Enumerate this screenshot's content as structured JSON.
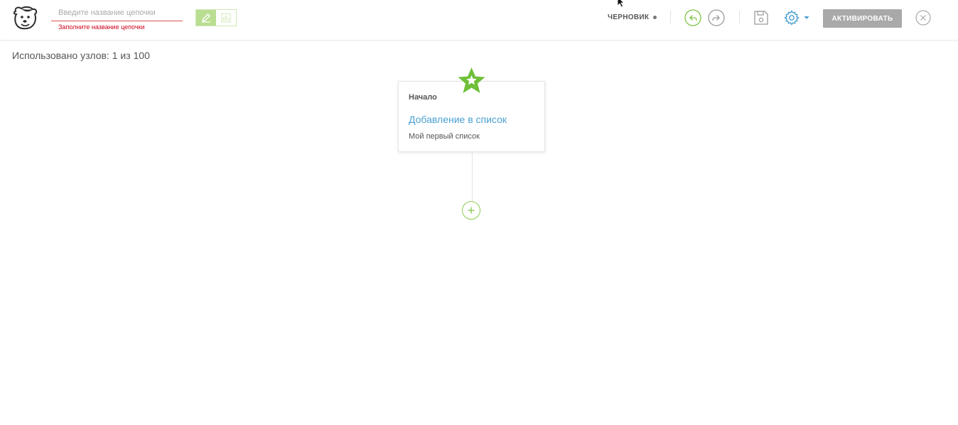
{
  "header": {
    "logo_icon": "mascot-dog-icon",
    "chain_name": {
      "value": "",
      "placeholder": "Введите название цепочки",
      "error": "Заполните название цепочки"
    },
    "mode_toggle": {
      "active": "edit",
      "edit_icon": "pencil-icon",
      "stats_icon": "bar-chart-icon"
    },
    "status_label": "ЧЕРНОВИК",
    "undo_icon": "undo-icon",
    "redo_icon": "redo-icon",
    "save_icon": "save-icon",
    "settings_icon": "gear-icon",
    "activate_label": "АКТИВИРОВАТЬ",
    "close_icon": "close-icon"
  },
  "canvas": {
    "usage_text": "Использовано узлов: 1 из 100",
    "start_node": {
      "type_label": "Начало",
      "title": "Добавление в список",
      "subtitle": "Мой первый список",
      "icon": "star-icon"
    },
    "add_icon": "plus-icon"
  },
  "colors": {
    "accent_green": "#7cc243",
    "link_blue": "#4a9fd0",
    "error_red": "#d0021b",
    "disabled_button": "#a9a9a9"
  }
}
